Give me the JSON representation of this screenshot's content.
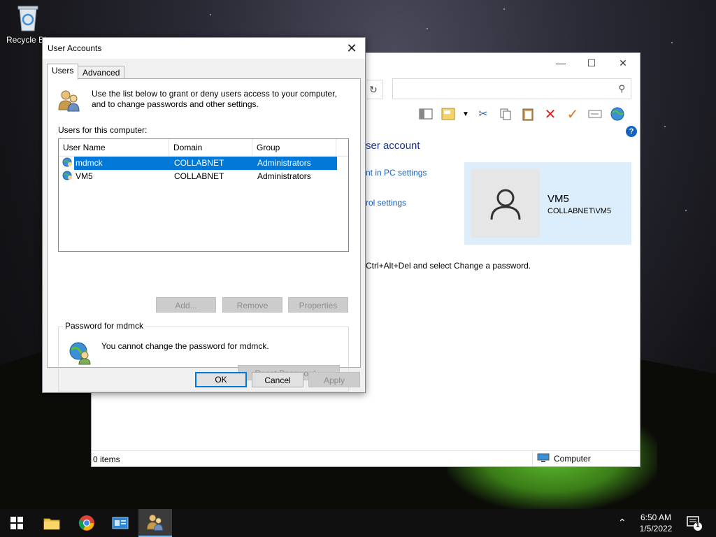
{
  "desktop": {
    "recycle_bin_label": "Recycle Bin"
  },
  "background_window": {
    "heading": "ser account",
    "link_pc_settings": "nt in PC settings",
    "link_control_settings": "rol settings",
    "cad_text": "Ctrl+Alt+Del and select Change a password.",
    "user_card": {
      "name": "VM5",
      "domain": "COLLABNET\\VM5"
    },
    "status_items": "0 items",
    "status_zone": "Computer"
  },
  "dialog": {
    "title": "User Accounts",
    "tabs": [
      "Users",
      "Advanced"
    ],
    "intro": "Use the list below to grant or deny users access to your computer, and to change passwords and other settings.",
    "users_label": "Users for this computer:",
    "columns": [
      "User Name",
      "Domain",
      "Group"
    ],
    "rows": [
      {
        "name": "mdmck",
        "domain": "COLLABNET",
        "group": "Administrators",
        "selected": true
      },
      {
        "name": "VM5",
        "domain": "COLLABNET",
        "group": "Administrators",
        "selected": false
      }
    ],
    "buttons": {
      "add": "Add...",
      "remove": "Remove",
      "properties": "Properties",
      "reset_password": "Reset Password...",
      "ok": "OK",
      "cancel": "Cancel",
      "apply": "Apply"
    },
    "password_group_label": "Password for mdmck",
    "password_message": "You cannot change the password for mdmck."
  },
  "taskbar": {
    "time": "6:50 AM",
    "date": "1/5/2022",
    "notification_count": "1"
  },
  "icons": [
    "windows-start-icon",
    "file-explorer-icon",
    "chrome-icon",
    "server-manager-icon",
    "user-accounts-icon"
  ]
}
